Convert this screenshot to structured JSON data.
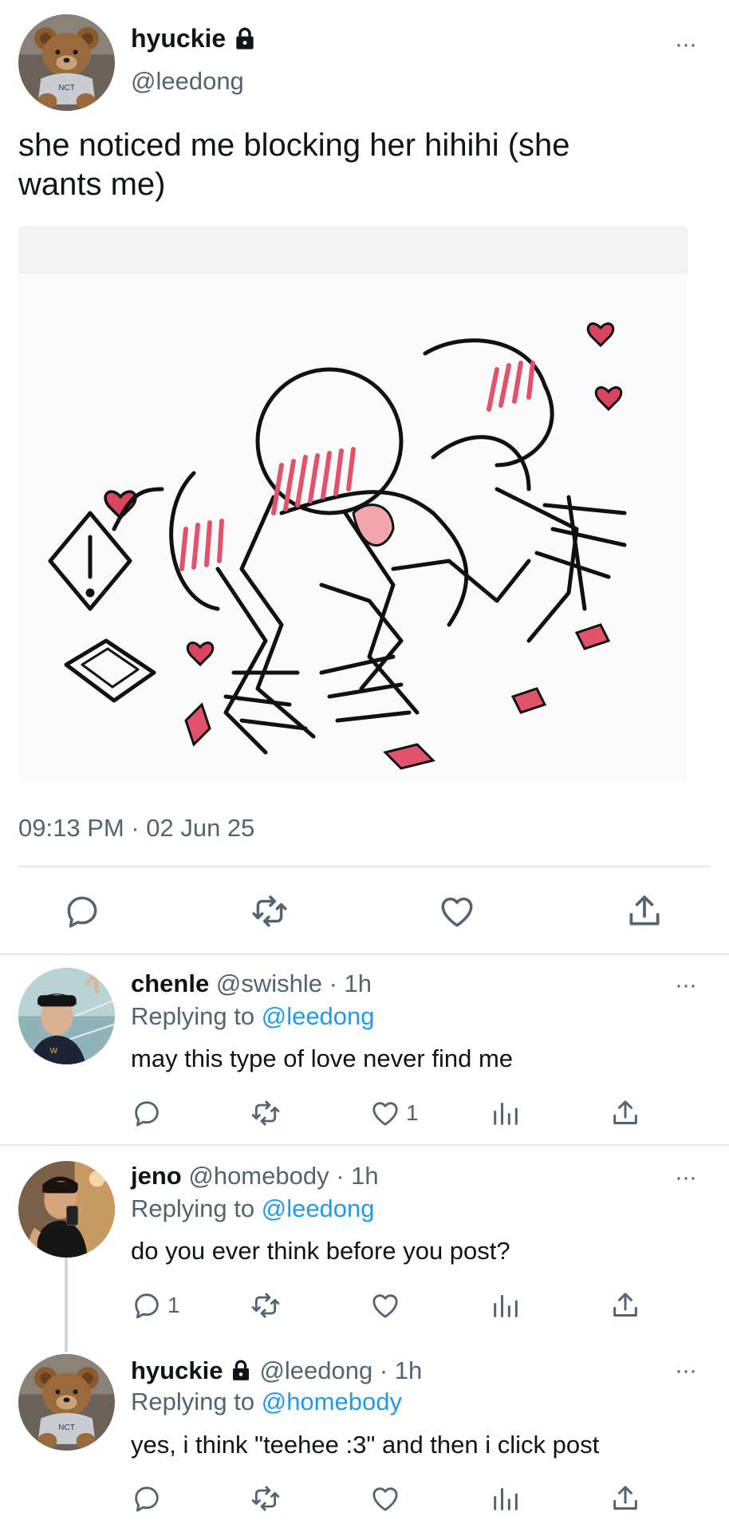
{
  "main_tweet": {
    "display_name": "hyuckie",
    "handle": "@leedong",
    "text_line1": "she noticed me blocking her hihihi (she",
    "text_line2": "wants me)",
    "timestamp": "09:13 PM · 02 Jun 25",
    "more": "···",
    "icons": [
      "lock-icon",
      "reply-icon",
      "retweet-icon",
      "like-icon",
      "share-icon"
    ]
  },
  "replies": [
    {
      "display_name": "chenle",
      "meta": "@swishle · 1h",
      "replying_prefix": "Replying to",
      "replying_to": "@leedong",
      "text": "may this type of love never find me",
      "reply_count": "",
      "like_count": "1",
      "more": "···"
    },
    {
      "display_name": "jeno",
      "meta": "@homebody · 1h",
      "replying_prefix": "Replying to",
      "replying_to": "@leedong",
      "text": "do you ever think before you post?",
      "reply_count": "1",
      "like_count": "",
      "more": "···"
    },
    {
      "display_name": "hyuckie",
      "meta": "@leedong · 1h",
      "replying_prefix": "Replying to",
      "replying_to": "@homebody",
      "text": "yes, i think \"teehee :3\" and then i click post",
      "reply_count": "",
      "like_count": "",
      "more": "···"
    }
  ],
  "colors": {
    "text": "#0f1419",
    "muted": "#536471",
    "link": "#1d9bf0",
    "divider": "#e6e9ec",
    "heart": "#e0536b"
  }
}
